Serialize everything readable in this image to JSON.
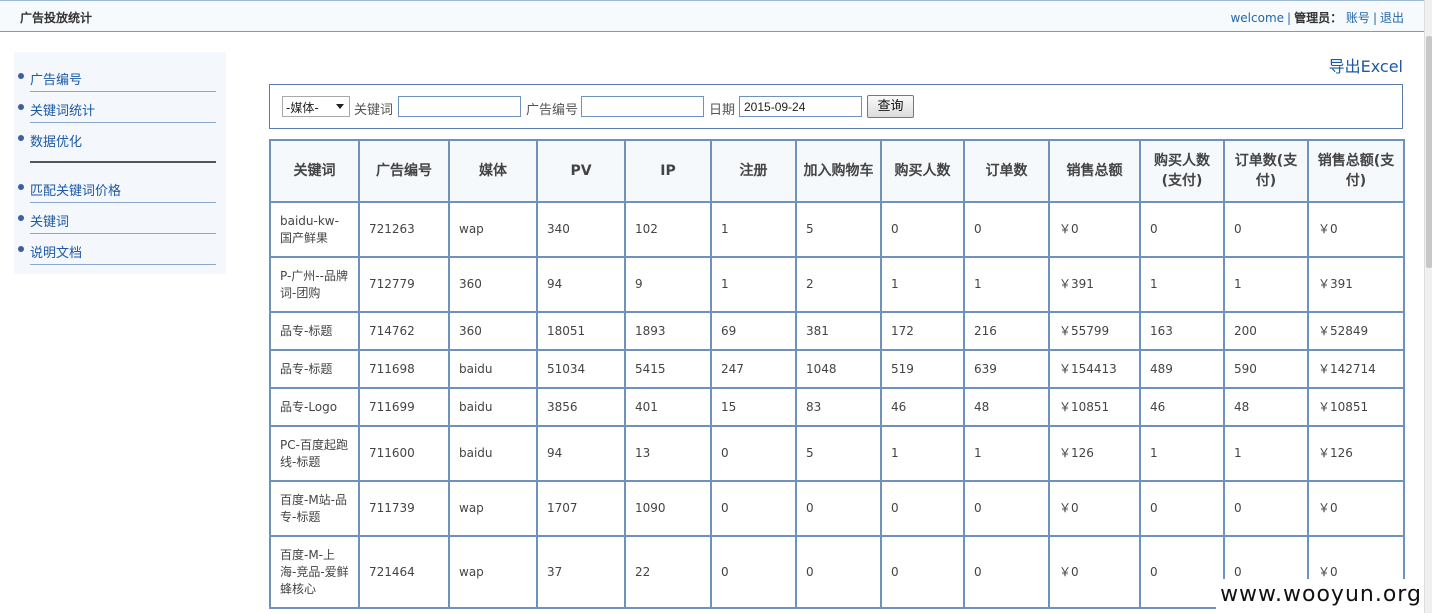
{
  "app": {
    "title": "广告投放统计"
  },
  "header": {
    "welcome": "welcome",
    "role_label": "管理员：",
    "account": "账号",
    "logout": "退出",
    "separator": "|"
  },
  "sidebar": {
    "items": [
      {
        "label": "广告编号"
      },
      {
        "label": "关键词统计"
      },
      {
        "label": "数据优化"
      },
      {
        "label": "匹配关键词价格"
      },
      {
        "label": "关键词"
      },
      {
        "label": "说明文档"
      }
    ]
  },
  "toolbar": {
    "export_label": "导出Excel"
  },
  "filter": {
    "media_selected": "-媒体-",
    "keyword_label": "关键词",
    "keyword_value": "",
    "ad_id_label": "广告编号",
    "ad_id_value": "",
    "date_label": "日期",
    "date_value": "2015-09-24",
    "query_label": "查询"
  },
  "table": {
    "headers": [
      "关键词",
      "广告编号",
      "媒体",
      "PV",
      "IP",
      "注册",
      "加入购物车",
      "购买人数",
      "订单数",
      "销售总额",
      "购买人数(支付)",
      "订单数(支付)",
      "销售总额(支付)"
    ],
    "rows": [
      [
        "baidu-kw-国产鲜果",
        "721263",
        "wap",
        "340",
        "102",
        "1",
        "5",
        "0",
        "0",
        "￥0",
        "0",
        "0",
        "￥0"
      ],
      [
        "P-广州--品牌词-团购",
        "712779",
        "360",
        "94",
        "9",
        "1",
        "2",
        "1",
        "1",
        "￥391",
        "1",
        "1",
        "￥391"
      ],
      [
        "品专-标题",
        "714762",
        "360",
        "18051",
        "1893",
        "69",
        "381",
        "172",
        "216",
        "￥55799",
        "163",
        "200",
        "￥52849"
      ],
      [
        "品专-标题",
        "711698",
        "baidu",
        "51034",
        "5415",
        "247",
        "1048",
        "519",
        "639",
        "￥154413",
        "489",
        "590",
        "￥142714"
      ],
      [
        "品专-Logo",
        "711699",
        "baidu",
        "3856",
        "401",
        "15",
        "83",
        "46",
        "48",
        "￥10851",
        "46",
        "48",
        "￥10851"
      ],
      [
        "PC-百度起跑线-标题",
        "711600",
        "baidu",
        "94",
        "13",
        "0",
        "5",
        "1",
        "1",
        "￥126",
        "1",
        "1",
        "￥126"
      ],
      [
        "百度-M站-品专-标题",
        "711739",
        "wap",
        "1707",
        "1090",
        "0",
        "0",
        "0",
        "0",
        "￥0",
        "0",
        "0",
        "￥0"
      ],
      [
        "百度-M-上海-竞品-爱鲜蜂核心",
        "721464",
        "wap",
        "37",
        "22",
        "0",
        "0",
        "0",
        "0",
        "￥0",
        "0",
        "0",
        "￥0"
      ]
    ]
  },
  "watermark": {
    "text": "www.wooyun.org"
  }
}
